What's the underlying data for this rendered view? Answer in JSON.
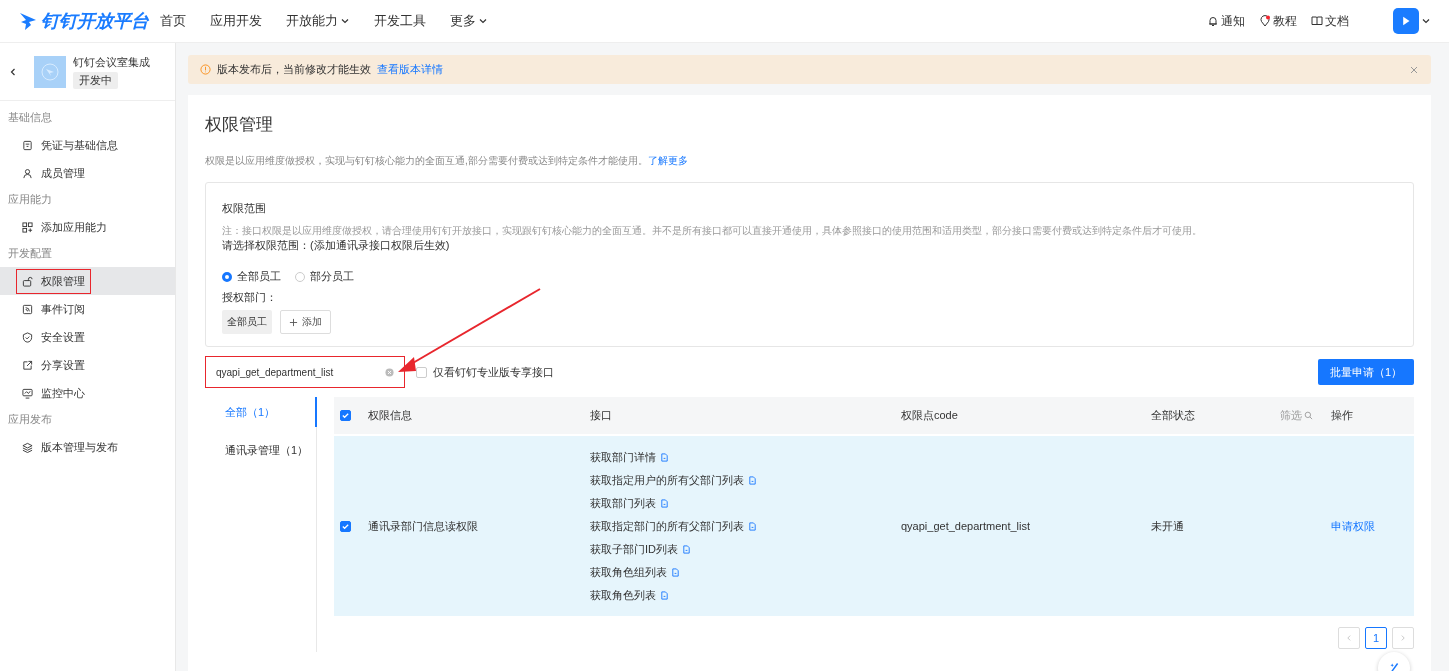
{
  "brand": "钉钉开放平台",
  "nav": [
    {
      "label": "首页",
      "dropdown": false
    },
    {
      "label": "应用开发",
      "dropdown": false
    },
    {
      "label": "开放能力",
      "dropdown": true
    },
    {
      "label": "开发工具",
      "dropdown": false
    },
    {
      "label": "更多",
      "dropdown": true
    }
  ],
  "nav_right": [
    {
      "label": "通知",
      "kind": "bell"
    },
    {
      "label": "教程",
      "kind": "pin"
    },
    {
      "label": "文档",
      "kind": "book"
    }
  ],
  "app": {
    "name": "钉钉会议室集成",
    "status": "开发中"
  },
  "sidebar": [
    {
      "title": "基础信息",
      "items": [
        {
          "label": "凭证与基础信息",
          "kind": "card",
          "selected": false,
          "highlighted": false
        },
        {
          "label": "成员管理",
          "kind": "user",
          "selected": false,
          "highlighted": false
        }
      ]
    },
    {
      "title": "应用能力",
      "items": [
        {
          "label": "添加应用能力",
          "kind": "grid",
          "selected": false,
          "highlighted": false
        }
      ]
    },
    {
      "title": "开发配置",
      "items": [
        {
          "label": "权限管理",
          "kind": "lock",
          "selected": true,
          "highlighted": true
        },
        {
          "label": "事件订阅",
          "kind": "rss",
          "selected": false,
          "highlighted": false
        },
        {
          "label": "安全设置",
          "kind": "shield",
          "selected": false,
          "highlighted": false
        },
        {
          "label": "分享设置",
          "kind": "share",
          "selected": false,
          "highlighted": false
        },
        {
          "label": "监控中心",
          "kind": "monitor",
          "selected": false,
          "highlighted": false
        }
      ]
    },
    {
      "title": "应用发布",
      "items": [
        {
          "label": "版本管理与发布",
          "kind": "layers",
          "selected": false,
          "highlighted": false
        }
      ]
    }
  ],
  "banner": {
    "text": "版本发布后，当前修改才能生效",
    "link": "查看版本详情"
  },
  "page": {
    "title": "权限管理",
    "description": "权限是以应用维度做授权，实现与钉钉核心能力的全面互通,部分需要付费或达到特定条件才能使用。",
    "link": "了解更多"
  },
  "scope": {
    "title": "权限范围",
    "note": "注：接口权限是以应用维度做授权，请合理使用钉钉开放接口，实现跟钉钉核心能力的全面互通。并不是所有接口都可以直接开通使用，具体参照接口的使用范围和适用类型，部分接口需要付费或达到特定条件后才可使用。",
    "prompt": "请选择权限范围：(添加通讯录接口权限后生效)",
    "options": [
      {
        "label": "全部员工",
        "selected": true
      },
      {
        "label": "部分员工",
        "selected": false
      }
    ],
    "dept_label": "授权部门：",
    "dept_tags": [
      "全部员工"
    ],
    "add_label": "添加"
  },
  "search": {
    "value": "qyapi_get_department_list",
    "highlighted": true
  },
  "only_pro": {
    "label": "仅看钉钉专业版专享接口",
    "checked": false
  },
  "batch_button": "批量申请（1）",
  "categories": [
    {
      "label": "全部（1）",
      "selected": true
    },
    {
      "label": "通讯录管理（1）",
      "selected": false
    }
  ],
  "table": {
    "all_checked": true,
    "columns": [
      "权限信息",
      "接口",
      "权限点code",
      "全部状态",
      "操作"
    ],
    "filter_label": "筛选",
    "rows": [
      {
        "checked": true,
        "name": "通讯录部门信息读权限",
        "apis": [
          "获取部门详情",
          "获取指定用户的所有父部门列表",
          "获取部门列表",
          "获取指定部门的所有父部门列表",
          "获取子部门ID列表",
          "获取角色组列表",
          "获取角色列表"
        ],
        "code": "qyapi_get_department_list",
        "status": "未开通",
        "action": "申请权限"
      }
    ]
  },
  "pagination": {
    "pages": [
      {
        "label": "1",
        "selected": true
      }
    ]
  }
}
